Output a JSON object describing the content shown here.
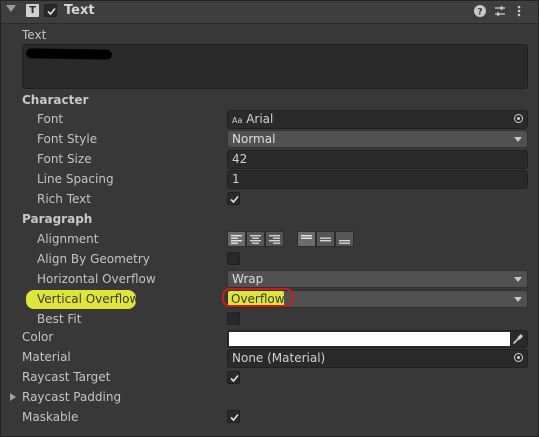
{
  "component": {
    "icon": "text-component-icon",
    "enabled": true,
    "title": "Text",
    "header_icons": [
      "help-icon",
      "presets-icon",
      "more-options-icon"
    ]
  },
  "text_section": {
    "label": "Text",
    "value_redacted": true
  },
  "character": {
    "heading": "Character",
    "font_label": "Font",
    "font_icon": "Aa",
    "font_value": "Arial",
    "font_style_label": "Font Style",
    "font_style_value": "Normal",
    "font_size_label": "Font Size",
    "font_size_value": "42",
    "line_spacing_label": "Line Spacing",
    "line_spacing_value": "1",
    "rich_text_label": "Rich Text",
    "rich_text_checked": true
  },
  "paragraph": {
    "heading": "Paragraph",
    "alignment_label": "Alignment",
    "alignment_horizontal": [
      "left",
      "center",
      "right"
    ],
    "alignment_vertical": [
      "top",
      "middle",
      "bottom"
    ],
    "align_by_geometry_label": "Align By Geometry",
    "align_by_geometry_checked": false,
    "horizontal_overflow_label": "Horizontal Overflow",
    "horizontal_overflow_value": "Wrap",
    "vertical_overflow_label": "Vertical Overflow",
    "vertical_overflow_value": "Overflow",
    "best_fit_label": "Best Fit",
    "best_fit_checked": false
  },
  "color": {
    "label": "Color",
    "value_hex": "#ffffff"
  },
  "material": {
    "label": "Material",
    "value": "None (Material)"
  },
  "raycast_target": {
    "label": "Raycast Target",
    "checked": true
  },
  "raycast_padding": {
    "label": "Raycast Padding",
    "expanded": false
  },
  "maskable": {
    "label": "Maskable",
    "checked": true
  },
  "colors": {
    "highlight": "#dfe53a",
    "annotation_red": "#c71d1d",
    "panel_bg": "#383838"
  }
}
